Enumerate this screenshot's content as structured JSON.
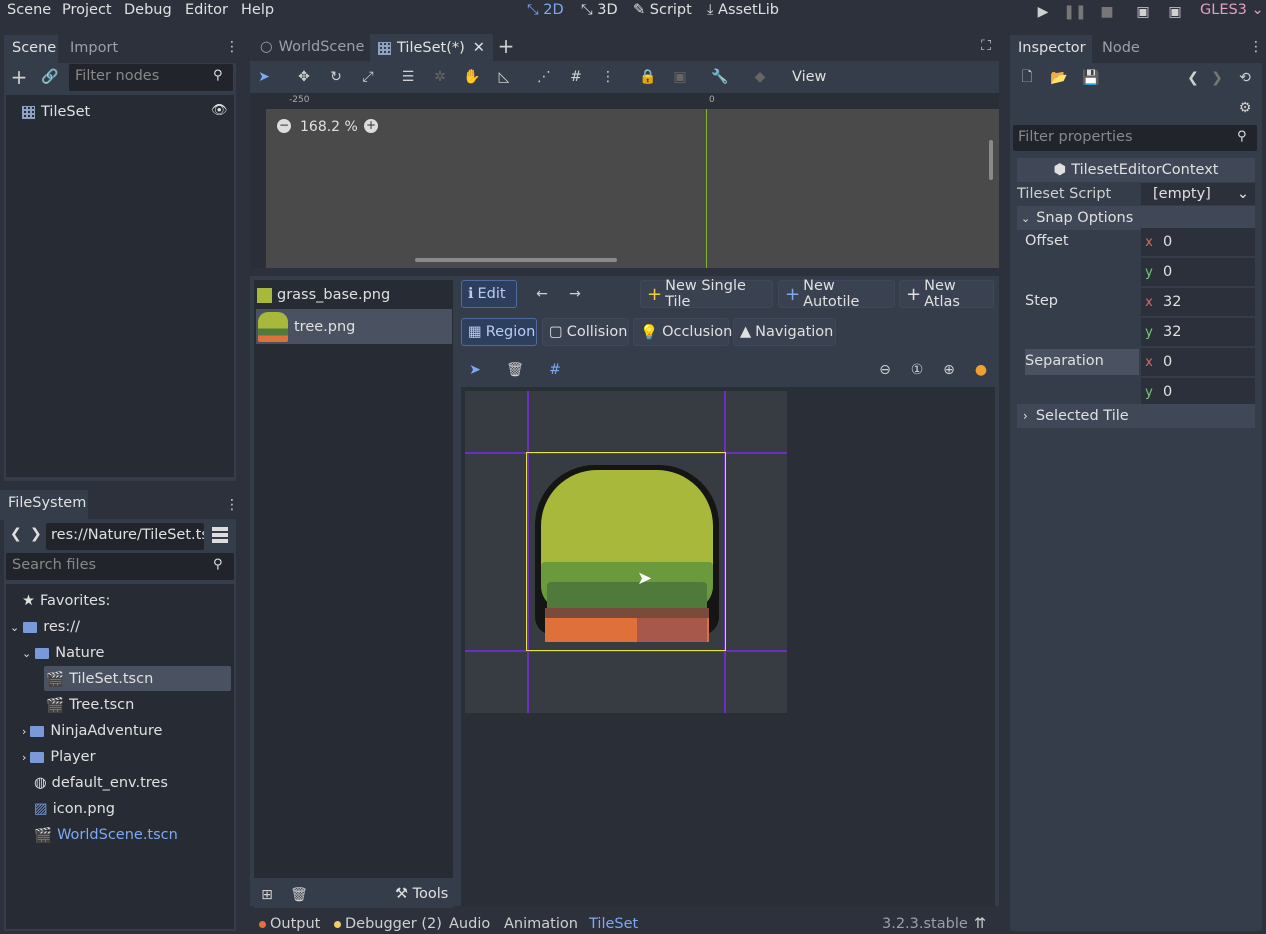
{
  "menu": {
    "scene": "Scene",
    "project": "Project",
    "debug": "Debug",
    "editor": "Editor",
    "help": "Help"
  },
  "modes": {
    "m2d": "2D",
    "m3d": "3D",
    "script": "Script",
    "assetlib": "AssetLib"
  },
  "renderer": "GLES3",
  "scene_dock": {
    "tab_scene": "Scene",
    "tab_import": "Import",
    "filter_placeholder": "Filter nodes",
    "root_node": "TileSet"
  },
  "filesystem": {
    "tab": "FileSystem",
    "path": "res://Nature/TileSet.ts",
    "search_placeholder": "Search files",
    "favorites": "Favorites:",
    "res": "res://",
    "nature": "Nature",
    "tileset_file": "TileSet.tscn",
    "tree_file": "Tree.tscn",
    "ninja": "NinjaAdventure",
    "player": "Player",
    "env": "default_env.tres",
    "icon": "icon.png",
    "world": "WorldScene.tscn"
  },
  "editor_tabs": {
    "world": "WorldScene",
    "tileset": "TileSet(*)"
  },
  "toolbar": {
    "view": "View"
  },
  "canvas": {
    "zoom": "168.2 %",
    "ruler_neg": "-250",
    "ruler_zero": "0"
  },
  "tileset_panel": {
    "textures": [
      {
        "name": "grass_base.png"
      },
      {
        "name": "tree.png"
      }
    ],
    "edit": "Edit",
    "new_single": "New Single Tile",
    "new_autotile": "New Autotile",
    "new_atlas": "New Atlas",
    "region": "Region",
    "collision": "Collision",
    "occlusion": "Occlusion",
    "navigation": "Navigation",
    "tools": "Tools"
  },
  "inspector": {
    "tab_inspector": "Inspector",
    "tab_node": "Node",
    "filter_placeholder": "Filter properties",
    "context": "TilesetEditorContext",
    "script_label": "Tileset Script",
    "script_value": "[empty]",
    "snap_options": "Snap Options",
    "offset": "Offset",
    "offset_x": "0",
    "offset_y": "0",
    "step": "Step",
    "step_x": "32",
    "step_y": "32",
    "separation": "Separation",
    "sep_x": "0",
    "sep_y": "0",
    "selected_tile": "Selected Tile",
    "x": "x",
    "y": "y"
  },
  "bottom": {
    "output": "Output",
    "debugger": "Debugger (2)",
    "audio": "Audio",
    "animation": "Animation",
    "tileset": "TileSet",
    "version": "3.2.3.stable"
  },
  "colors": {
    "accent": "#7ea9f0",
    "tree_light": "#a8b83a",
    "tree_dark": "#4f7a3c",
    "trunk": "#e0703a",
    "guide": "#6a2fc0",
    "selection": "#e6e24a"
  }
}
